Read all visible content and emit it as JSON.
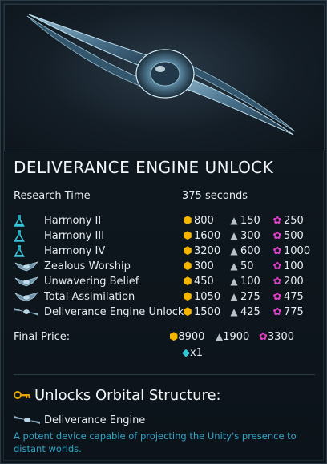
{
  "title": "DELIVERANCE ENGINE UNLOCK",
  "research_time": {
    "label": "Research Time",
    "value": "375 seconds"
  },
  "requirements": [
    {
      "name": "Harmony II",
      "icon": "flask-icon",
      "gold": "800",
      "grey": "150",
      "pink": "250"
    },
    {
      "name": "Harmony III",
      "icon": "flask-icon",
      "gold": "1600",
      "grey": "300",
      "pink": "500"
    },
    {
      "name": "Harmony IV",
      "icon": "flask-icon",
      "gold": "3200",
      "grey": "600",
      "pink": "1000"
    },
    {
      "name": "Zealous Worship",
      "icon": "ship-icon",
      "gold": "300",
      "grey": "50",
      "pink": "100"
    },
    {
      "name": "Unwavering Belief",
      "icon": "ship-icon",
      "gold": "450",
      "grey": "100",
      "pink": "200"
    },
    {
      "name": "Total Assimilation",
      "icon": "ship-icon",
      "gold": "1050",
      "grey": "275",
      "pink": "475"
    },
    {
      "name": "Deliverance Engine Unlock",
      "icon": "engine-icon",
      "gold": "1500",
      "grey": "425",
      "pink": "775"
    }
  ],
  "final_price": {
    "label": "Final Price:",
    "gold": "8900",
    "grey": "1900",
    "pink": "3300",
    "gem": "x1"
  },
  "unlocks": {
    "heading": "Unlocks Orbital Structure:",
    "structure_name": "Deliverance Engine",
    "description": "A potent device capable of projecting the Unity's presence to distant worlds."
  },
  "icons": {
    "gold": "hexagon-icon",
    "grey": "crystals-icon",
    "pink": "flower-icon",
    "gem": "diamond-icon",
    "key": "key-icon"
  },
  "colors": {
    "gold": "#f4b400",
    "grey": "#b9c2c8",
    "pink": "#e040c8",
    "cyan": "#36c4d8",
    "description": "#2fa6c8"
  }
}
